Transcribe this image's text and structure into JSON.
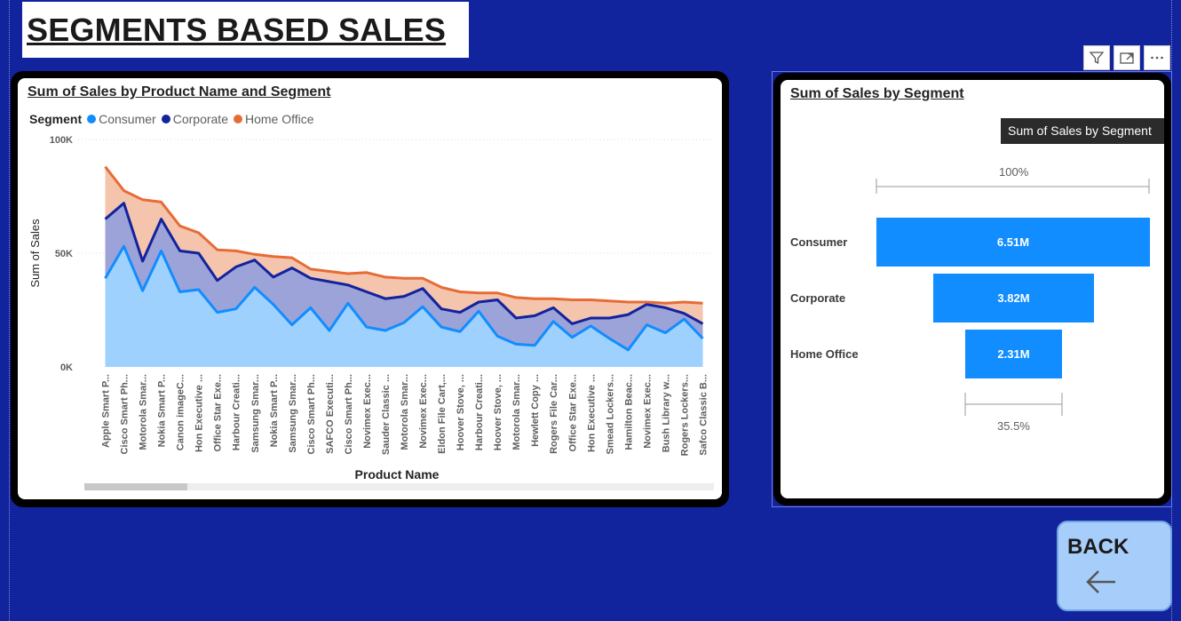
{
  "page": {
    "title": "SEGMENTS BASED SALES",
    "back_label": "BACK"
  },
  "area_chart_visual": {
    "title": "Sum of Sales by Product Name and Segment",
    "legend_title": "Segment"
  },
  "funnel_visual": {
    "title": "Sum of Sales by Segment",
    "tooltip": "Sum of Sales by Segment",
    "top_pct": "100%",
    "bottom_pct": "35.5%"
  },
  "colors": {
    "background": "#12239e",
    "consumer": "#118dff",
    "corporate": "#12239e",
    "home_office": "#e66c37",
    "consumer_fill": "#9fd1ff",
    "corporate_fill": "#9ca3d8",
    "home_office_fill": "#f5c4ad"
  },
  "icons": {
    "filter": "filter-icon",
    "focus": "focus-mode-icon",
    "more": "more-options-icon",
    "back_arrow": "arrow-left-icon"
  },
  "chart_data": [
    {
      "type": "area",
      "title": "Sum of Sales by Product Name and Segment",
      "xlabel": "Product Name",
      "ylabel": "Sum of Sales",
      "ylim": [
        0,
        100000
      ],
      "yticks": [
        "0K",
        "50K",
        "100K"
      ],
      "grid": true,
      "legend": "top-left",
      "stacked": true,
      "categories": [
        "Apple Smart P...",
        "Cisco Smart Ph...",
        "Motorola Smar...",
        "Nokia Smart P...",
        "Canon imageC...",
        "Hon Executive ...",
        "Office Star Exe...",
        "Harbour Creati...",
        "Samsung Smar...",
        "Nokia Smart P...",
        "Samsung Smar...",
        "Cisco Smart Ph...",
        "SAFCO Executi...",
        "Cisco Smart Ph...",
        "Novimex Exec...",
        "Sauder Classic ...",
        "Motorola Smar...",
        "Novimex Exec...",
        "Eldon File Cart,...",
        "Hoover Stove, ...",
        "Harbour Creati...",
        "Hoover Stove, ...",
        "Motorola Smar...",
        "Hewlett Copy ...",
        "Rogers File Car...",
        "Office Star Exe...",
        "Hon Executive ...",
        "Smead Lockers...",
        "Hamilton Beac...",
        "Novimex Exec...",
        "Bush Library w...",
        "Rogers Lockers...",
        "Safco Classic B..."
      ],
      "series": [
        {
          "name": "Consumer",
          "values": [
            39000,
            53000,
            33500,
            51000,
            33000,
            34000,
            24000,
            25500,
            35000,
            27500,
            18500,
            26000,
            16000,
            28000,
            17500,
            16000,
            19500,
            26500,
            17500,
            15500,
            24500,
            13500,
            10000,
            9500,
            20000,
            13000,
            18000,
            12500,
            7500,
            18500,
            15000,
            21000,
            12500
          ]
        },
        {
          "name": "Corporate",
          "values": [
            26000,
            19000,
            13000,
            14000,
            18000,
            16000,
            14000,
            18500,
            12000,
            12000,
            25000,
            13000,
            21500,
            8000,
            15500,
            14000,
            11500,
            8000,
            8000,
            8500,
            4000,
            16000,
            11500,
            13000,
            6000,
            6000,
            3500,
            9000,
            15500,
            9000,
            11000,
            2500,
            6500
          ]
        },
        {
          "name": "Home Office",
          "values": [
            23000,
            5500,
            27000,
            7500,
            11000,
            9000,
            13500,
            7000,
            2500,
            9000,
            4500,
            4000,
            4500,
            5000,
            8500,
            9500,
            8000,
            4500,
            9500,
            9000,
            4000,
            3000,
            9000,
            7500,
            4000,
            10500,
            8000,
            7500,
            5500,
            1000,
            2000,
            5000,
            9000
          ]
        }
      ]
    },
    {
      "type": "funnel",
      "title": "Sum of Sales by Segment",
      "categories": [
        "Consumer",
        "Corporate",
        "Home Office"
      ],
      "values": [
        6510000,
        3820000,
        2310000
      ],
      "value_labels": [
        "6.51M",
        "3.82M",
        "2.31M"
      ]
    }
  ]
}
